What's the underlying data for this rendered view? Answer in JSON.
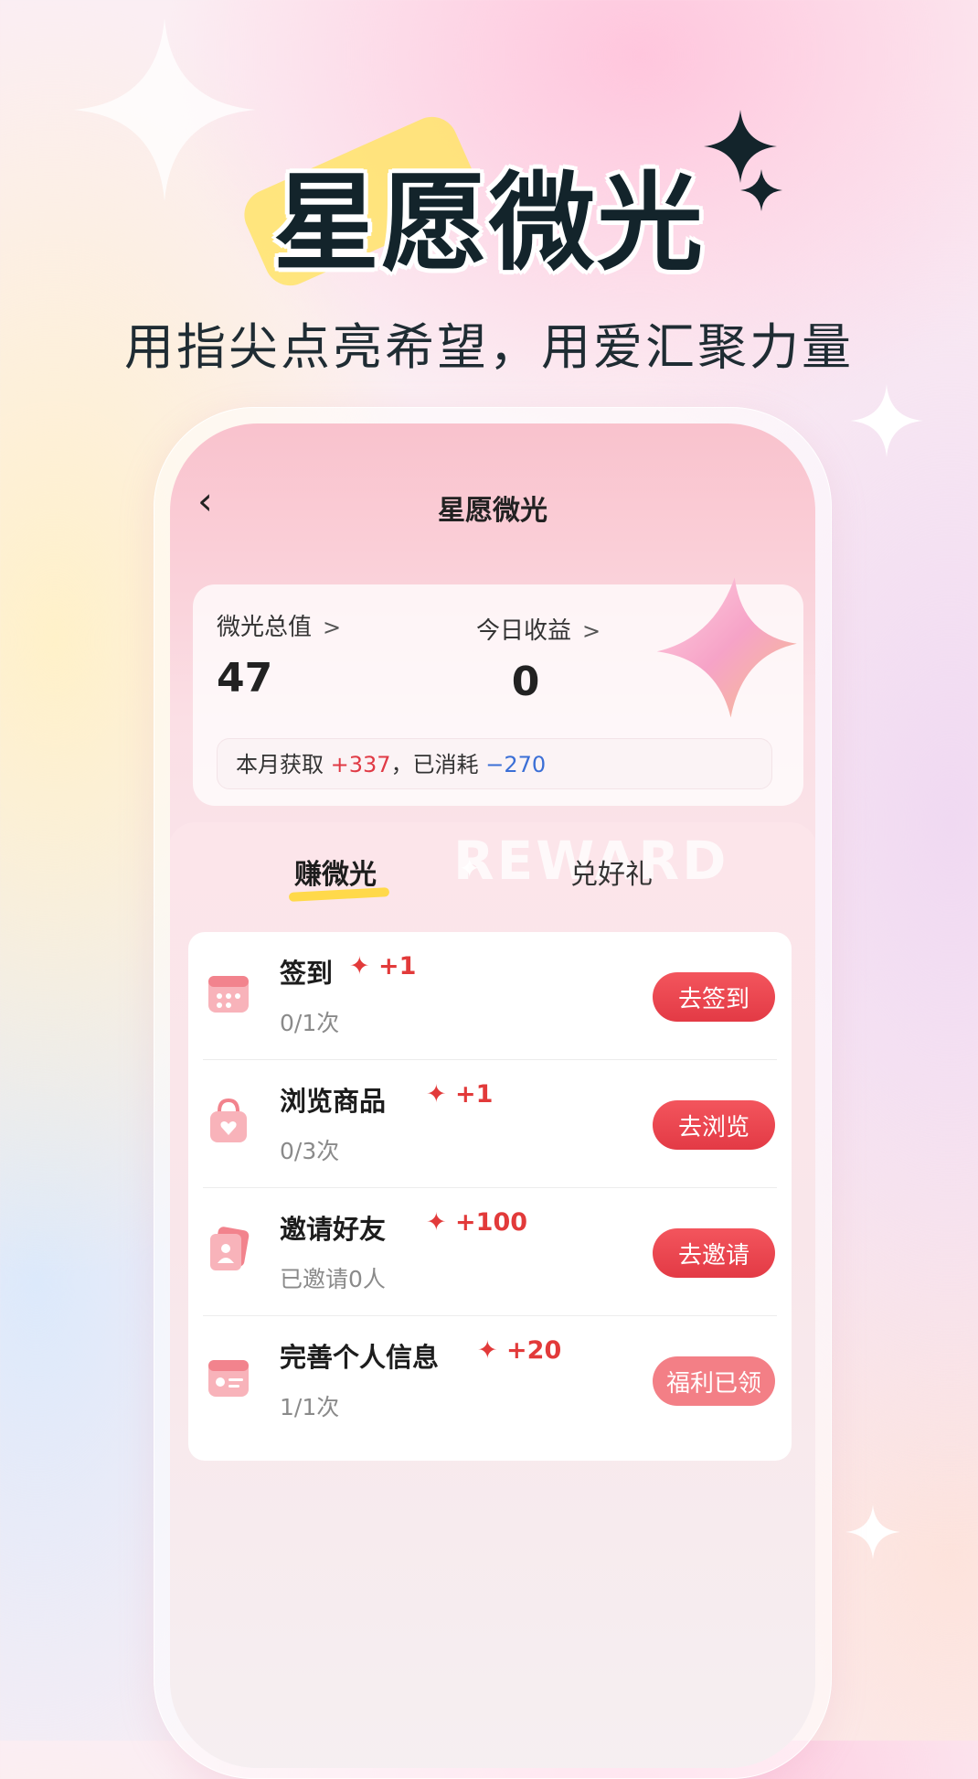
{
  "headline": "星愿微光",
  "subhead": "用指尖点亮希望，用爱汇聚力量",
  "nav": {
    "back_icon": "‹",
    "title": "星愿微光"
  },
  "stats": {
    "total_label": "微光总值",
    "total_value": "47",
    "today_label": "今日收益",
    "today_value": "0",
    "chevron": ">",
    "month_prefix": "本月获取",
    "month_gain": "+337",
    "month_sep": "，已消耗",
    "month_spent": "−270"
  },
  "tabs": {
    "active": "赚微光",
    "inactive": "兑好礼",
    "watermark": "REWARD"
  },
  "tasks": [
    {
      "title": "签到",
      "reward": "+1",
      "progress": "0/1次",
      "button": "去签到",
      "icon": "calendar-icon",
      "done": false
    },
    {
      "title": "浏览商品",
      "reward": "+1",
      "progress": "0/3次",
      "button": "去浏览",
      "icon": "shopping-bag-icon",
      "done": false
    },
    {
      "title": "邀请好友",
      "reward": "+100",
      "progress": "已邀请0人",
      "button": "去邀请",
      "icon": "invite-card-icon",
      "done": false
    },
    {
      "title": "完善个人信息",
      "reward": "+20",
      "progress": "1/1次",
      "button": "福利已领",
      "icon": "id-card-icon",
      "done": true
    }
  ],
  "colors": {
    "accent": "#e33a45",
    "gain": "#e03a45",
    "spent": "#3b6fd6"
  }
}
